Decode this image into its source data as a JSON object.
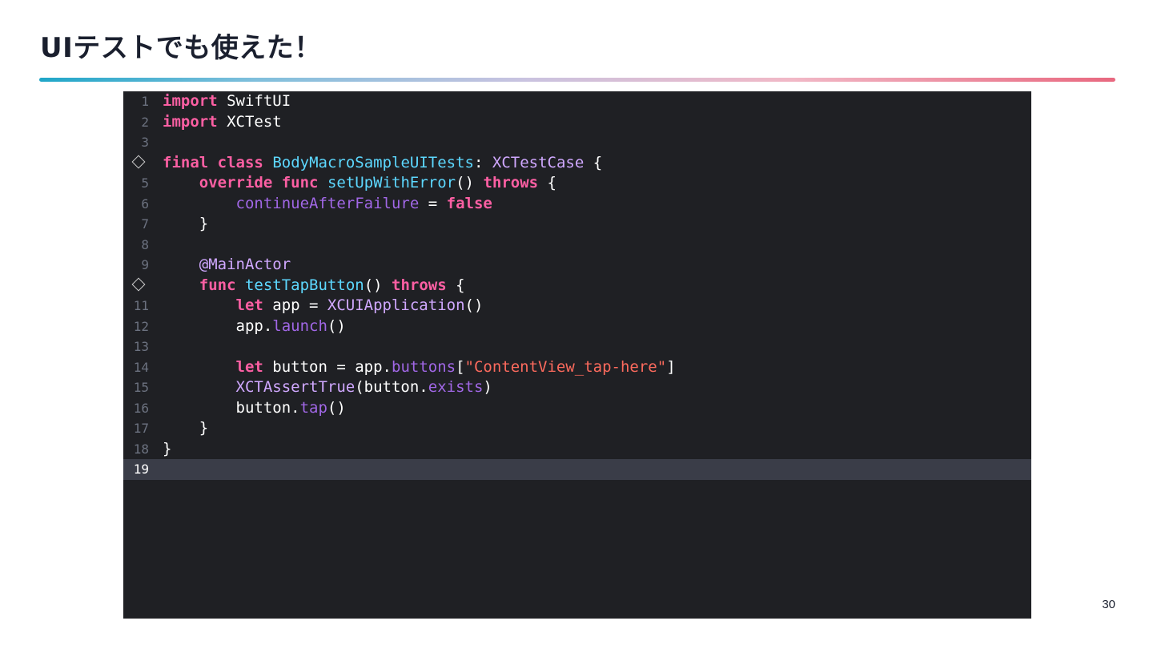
{
  "slide": {
    "title": "UIテストでも使えた！",
    "page_number": "30"
  },
  "editor": {
    "current_line": 19,
    "lines": [
      {
        "n": "1",
        "marker": false,
        "tokens": [
          {
            "t": "import",
            "k": "kw"
          },
          {
            "t": " SwiftUI",
            "k": "plain"
          }
        ]
      },
      {
        "n": "2",
        "marker": false,
        "tokens": [
          {
            "t": "import",
            "k": "kw"
          },
          {
            "t": " XCTest",
            "k": "plain"
          }
        ]
      },
      {
        "n": "3",
        "marker": false,
        "tokens": []
      },
      {
        "n": "4",
        "marker": true,
        "tokens": [
          {
            "t": "final",
            "k": "kw"
          },
          {
            "t": " ",
            "k": "plain"
          },
          {
            "t": "class",
            "k": "kw"
          },
          {
            "t": " ",
            "k": "plain"
          },
          {
            "t": "BodyMacroSampleUITests",
            "k": "type"
          },
          {
            "t": ": ",
            "k": "plain"
          },
          {
            "t": "XCTestCase",
            "k": "class"
          },
          {
            "t": " {",
            "k": "plain"
          }
        ]
      },
      {
        "n": "5",
        "marker": false,
        "tokens": [
          {
            "t": "    ",
            "k": "plain"
          },
          {
            "t": "override",
            "k": "kw"
          },
          {
            "t": " ",
            "k": "plain"
          },
          {
            "t": "func",
            "k": "kw"
          },
          {
            "t": " ",
            "k": "plain"
          },
          {
            "t": "setUpWithError",
            "k": "type"
          },
          {
            "t": "() ",
            "k": "plain"
          },
          {
            "t": "throws",
            "k": "kw"
          },
          {
            "t": " {",
            "k": "plain"
          }
        ]
      },
      {
        "n": "6",
        "marker": false,
        "tokens": [
          {
            "t": "        ",
            "k": "plain"
          },
          {
            "t": "continueAfterFailure",
            "k": "prop"
          },
          {
            "t": " = ",
            "k": "plain"
          },
          {
            "t": "false",
            "k": "kw"
          }
        ]
      },
      {
        "n": "7",
        "marker": false,
        "tokens": [
          {
            "t": "    }",
            "k": "plain"
          }
        ]
      },
      {
        "n": "8",
        "marker": false,
        "tokens": []
      },
      {
        "n": "9",
        "marker": false,
        "tokens": [
          {
            "t": "    ",
            "k": "plain"
          },
          {
            "t": "@MainActor",
            "k": "class"
          }
        ]
      },
      {
        "n": "10",
        "marker": true,
        "tokens": [
          {
            "t": "    ",
            "k": "plain"
          },
          {
            "t": "func",
            "k": "kw"
          },
          {
            "t": " ",
            "k": "plain"
          },
          {
            "t": "testTapButton",
            "k": "type"
          },
          {
            "t": "() ",
            "k": "plain"
          },
          {
            "t": "throws",
            "k": "kw"
          },
          {
            "t": " {",
            "k": "plain"
          }
        ]
      },
      {
        "n": "11",
        "marker": false,
        "tokens": [
          {
            "t": "        ",
            "k": "plain"
          },
          {
            "t": "let",
            "k": "kw"
          },
          {
            "t": " app = ",
            "k": "plain"
          },
          {
            "t": "XCUIApplication",
            "k": "class"
          },
          {
            "t": "()",
            "k": "plain"
          }
        ]
      },
      {
        "n": "12",
        "marker": false,
        "tokens": [
          {
            "t": "        app.",
            "k": "plain"
          },
          {
            "t": "launch",
            "k": "prop"
          },
          {
            "t": "()",
            "k": "plain"
          }
        ]
      },
      {
        "n": "13",
        "marker": false,
        "tokens": []
      },
      {
        "n": "14",
        "marker": false,
        "tokens": [
          {
            "t": "        ",
            "k": "plain"
          },
          {
            "t": "let",
            "k": "kw"
          },
          {
            "t": " button = app.",
            "k": "plain"
          },
          {
            "t": "buttons",
            "k": "prop"
          },
          {
            "t": "[",
            "k": "plain"
          },
          {
            "t": "\"ContentView_tap-here\"",
            "k": "str"
          },
          {
            "t": "]",
            "k": "plain"
          }
        ]
      },
      {
        "n": "15",
        "marker": false,
        "tokens": [
          {
            "t": "        ",
            "k": "plain"
          },
          {
            "t": "XCTAssertTrue",
            "k": "class"
          },
          {
            "t": "(button.",
            "k": "plain"
          },
          {
            "t": "exists",
            "k": "prop"
          },
          {
            "t": ")",
            "k": "plain"
          }
        ]
      },
      {
        "n": "16",
        "marker": false,
        "tokens": [
          {
            "t": "        button.",
            "k": "plain"
          },
          {
            "t": "tap",
            "k": "prop"
          },
          {
            "t": "()",
            "k": "plain"
          }
        ]
      },
      {
        "n": "17",
        "marker": false,
        "tokens": [
          {
            "t": "    }",
            "k": "plain"
          }
        ]
      },
      {
        "n": "18",
        "marker": false,
        "tokens": [
          {
            "t": "}",
            "k": "plain"
          }
        ]
      },
      {
        "n": "19",
        "marker": false,
        "tokens": []
      }
    ]
  }
}
